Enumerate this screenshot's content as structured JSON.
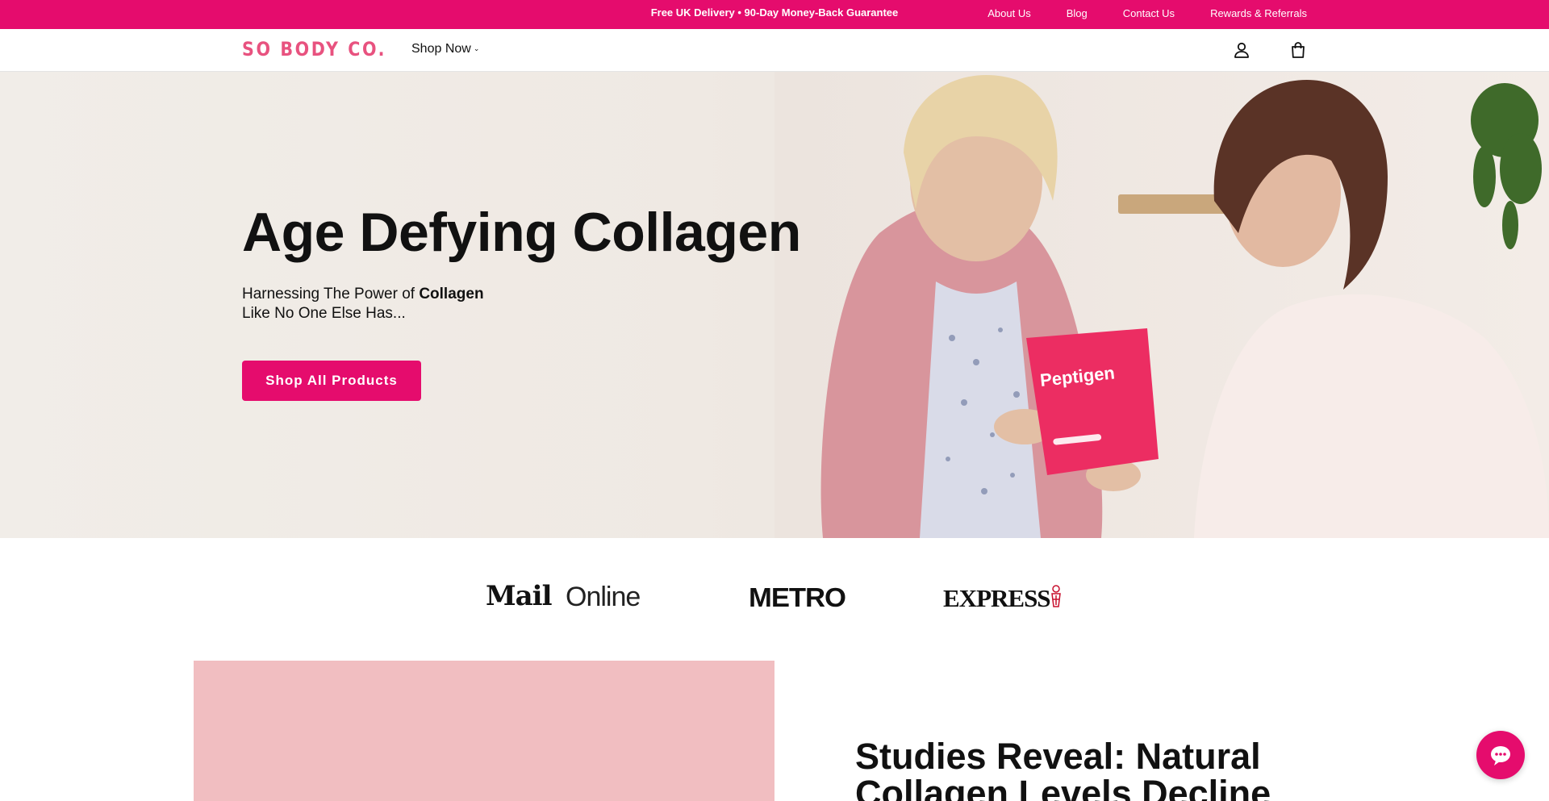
{
  "announcement": {
    "promo": "Free UK Delivery • 90-Day Money-Back Guarantee",
    "links": [
      "About Us",
      "Blog",
      "Contact Us",
      "Rewards & Referrals"
    ]
  },
  "header": {
    "logo": "SO BODY CO.",
    "nav_shop": "Shop Now",
    "icons": [
      "account-icon",
      "cart-icon"
    ]
  },
  "hero": {
    "title": "Age Defying Collagen",
    "subtitle_prefix": "Harnessing The Power of ",
    "subtitle_bold": "Collagen",
    "subtitle_line2": "Like No One Else Has...",
    "cta": "Shop All Products",
    "product_label": "Peptigen"
  },
  "press": {
    "mail_a": "Mail",
    "mail_b": "Online",
    "metro": "METRO",
    "express": "EXPRESS"
  },
  "section": {
    "heading": "Studies Reveal: Natural Collagen Levels Decline"
  },
  "colors": {
    "brand_pink": "#e50c6d",
    "logo_pink": "#e8527f",
    "block_pink": "#f1bec1"
  }
}
